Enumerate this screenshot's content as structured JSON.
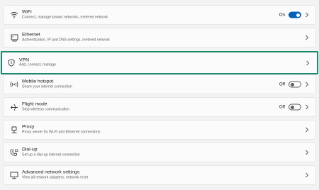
{
  "rows": [
    {
      "title": "WiFi",
      "subtitle": "Connect, manage known networks, metered network",
      "icon": "wifi-icon",
      "toggle_label": "On"
    },
    {
      "title": "Ethernet",
      "subtitle": "Authentication, IP and DNS settings, metered network",
      "icon": "ethernet-icon"
    },
    {
      "title": "VPN",
      "subtitle": "Add, connect, manage",
      "icon": "vpn-shield-icon"
    },
    {
      "title": "Mobile hotspot",
      "subtitle": "Share your internet connection",
      "icon": "hotspot-icon",
      "toggle_label": "Off"
    },
    {
      "title": "Flight mode",
      "subtitle": "Stop wireless communication",
      "icon": "airplane-icon",
      "toggle_label": "Off"
    },
    {
      "title": "Proxy",
      "subtitle": "Proxy server for Wi-Fi and Ethernet connections",
      "icon": "proxy-icon"
    },
    {
      "title": "Dial-up",
      "subtitle": "Set up a dial-up internet connection",
      "icon": "dialup-icon"
    },
    {
      "title": "Advanced network settings",
      "subtitle": "View all network adapters, network reset",
      "icon": "advanced-network-icon"
    }
  ],
  "colors": {
    "accent": "#005fb8",
    "highlight": "#1e8a6a"
  }
}
